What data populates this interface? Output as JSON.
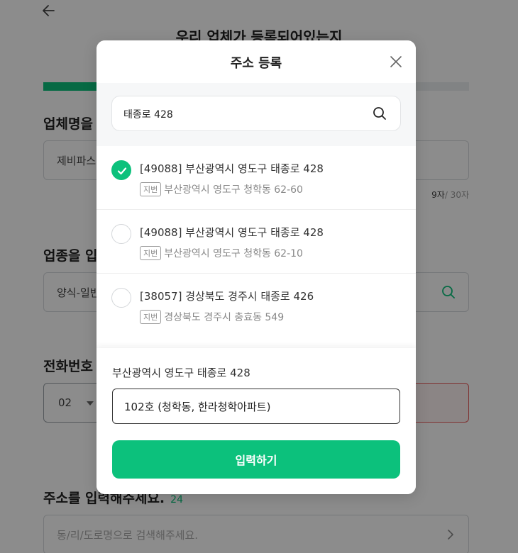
{
  "page": {
    "title": "우리 업체가 등록되어있는지",
    "sections": {
      "business_name": {
        "label": "업체명을",
        "value": "제비파스",
        "counter_current": "9자",
        "counter_max": "/ 30자"
      },
      "business_type": {
        "label": "업종을 입",
        "value": "양식-일반"
      },
      "phone": {
        "label": "전화번호",
        "area_code": "02"
      },
      "address": {
        "label": "주소를 입력해주세요.",
        "required_mark": "24",
        "placeholder": "동/리/도로명으로 검색해주세요."
      }
    }
  },
  "modal": {
    "title": "주소 등록",
    "search": {
      "value": "태종로 428"
    },
    "results": [
      {
        "road_address": "[49088] 부산광역시 영도구 태종로 428",
        "badge": "지번",
        "jibun_address": "부산광역시 영도구 청학동 62-60",
        "selected": true
      },
      {
        "road_address": "[49088] 부산광역시 영도구 태종로 428",
        "badge": "지번",
        "jibun_address": "부산광역시 영도구 청학동 62-10",
        "selected": false
      },
      {
        "road_address": "[38057] 경상북도 경주시 태종로 426",
        "badge": "지번",
        "jibun_address": "경상북도 경주시 충효동 549",
        "selected": false
      }
    ],
    "detail": {
      "selected_address": "부산광역시 영도구 태종로 428",
      "detail_value": "102호 (청학동, 한라청학아파트)"
    },
    "submit_label": "입력하기"
  },
  "colors": {
    "accent": "#0cc17c",
    "error": "#e85a5a"
  },
  "icons": [
    "back-arrow-icon",
    "close-icon",
    "search-icon",
    "check-icon",
    "chevron-right-icon"
  ]
}
